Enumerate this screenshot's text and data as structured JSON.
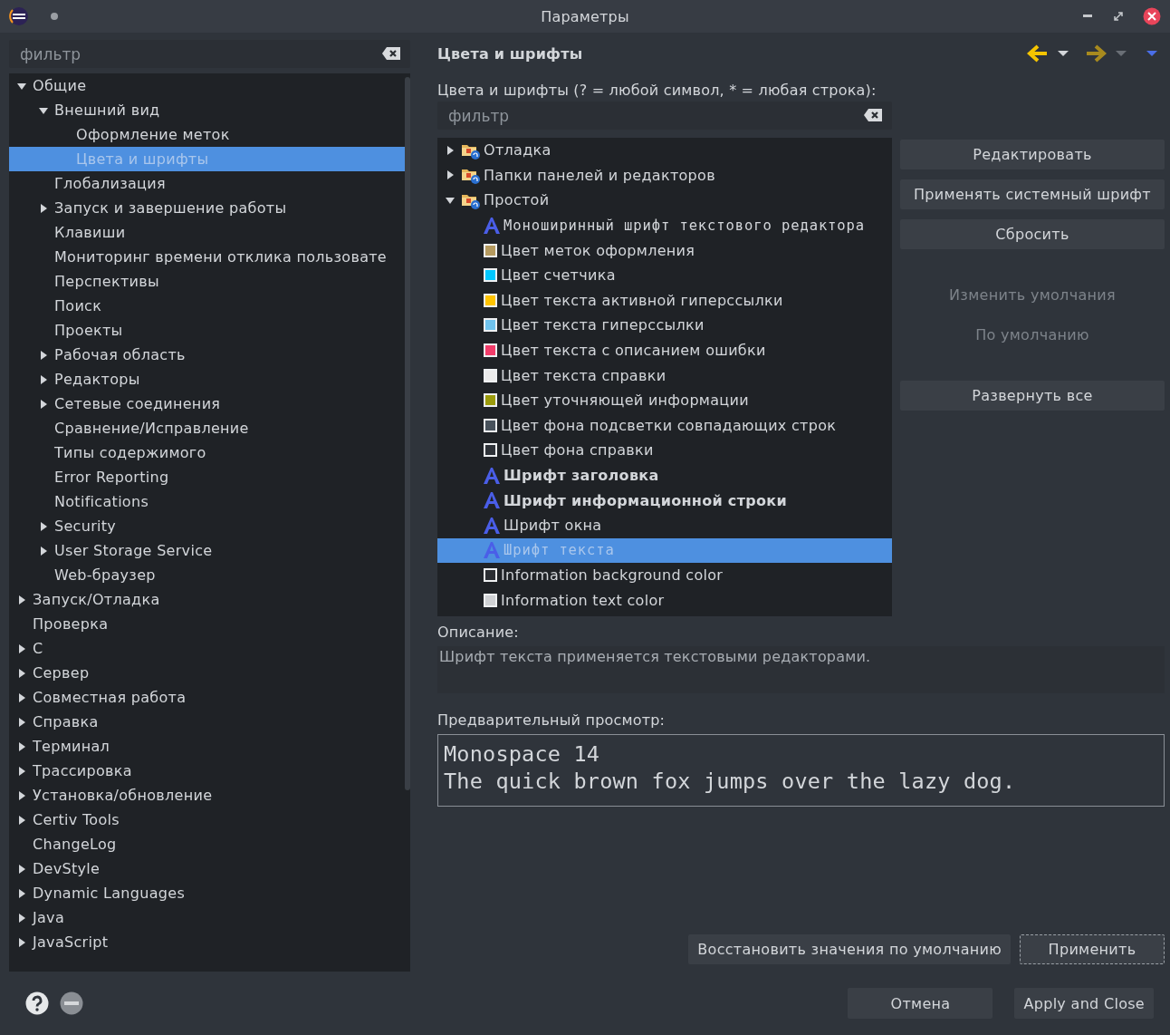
{
  "window": {
    "title": "Параметры"
  },
  "sidebar": {
    "filter_placeholder": "фильтр",
    "tree": [
      {
        "label": "Общие",
        "expanded": true,
        "selected": false,
        "children": [
          {
            "label": "Внешний вид",
            "expanded": true,
            "selected": false,
            "children": [
              {
                "label": "Оформление меток",
                "selected": false
              },
              {
                "label": "Цвета и шрифты",
                "selected": true
              }
            ]
          },
          {
            "label": "Глобализация",
            "selected": false
          },
          {
            "label": "Запуск и завершение работы",
            "expanded": false,
            "selected": false
          },
          {
            "label": "Клавиши",
            "selected": false
          },
          {
            "label": "Мониторинг времени отклика пользовате",
            "selected": false
          },
          {
            "label": "Перспективы",
            "selected": false
          },
          {
            "label": "Поиск",
            "selected": false
          },
          {
            "label": "Проекты",
            "selected": false
          },
          {
            "label": "Рабочая область",
            "expanded": false,
            "selected": false
          },
          {
            "label": "Редакторы",
            "expanded": false,
            "selected": false
          },
          {
            "label": "Сетевые соединения",
            "expanded": false,
            "selected": false
          },
          {
            "label": "Сравнение/Исправление",
            "selected": false
          },
          {
            "label": "Типы содержимого",
            "selected": false
          },
          {
            "label": "Error Reporting",
            "selected": false
          },
          {
            "label": "Notifications",
            "selected": false
          },
          {
            "label": "Security",
            "expanded": false,
            "selected": false
          },
          {
            "label": "User Storage Service",
            "expanded": false,
            "selected": false
          },
          {
            "label": "Web-браузер",
            "selected": false
          }
        ]
      },
      {
        "label": "Запуск/Отладка",
        "expanded": false,
        "selected": false
      },
      {
        "label": "Проверка",
        "selected": false
      },
      {
        "label": "C",
        "expanded": false,
        "selected": false
      },
      {
        "label": "Сервер",
        "expanded": false,
        "selected": false
      },
      {
        "label": "Совместная работа",
        "expanded": false,
        "selected": false
      },
      {
        "label": "Справка",
        "expanded": false,
        "selected": false
      },
      {
        "label": "Терминал",
        "expanded": false,
        "selected": false
      },
      {
        "label": "Трассировка",
        "expanded": false,
        "selected": false
      },
      {
        "label": "Установка/обновление",
        "expanded": false,
        "selected": false
      },
      {
        "label": "Certiv Tools",
        "expanded": false,
        "selected": false
      },
      {
        "label": "ChangeLog",
        "selected": false
      },
      {
        "label": "DevStyle",
        "expanded": false,
        "selected": false
      },
      {
        "label": "Dynamic Languages",
        "expanded": false,
        "selected": false
      },
      {
        "label": "Java",
        "expanded": false,
        "selected": false
      },
      {
        "label": "JavaScript",
        "expanded": false,
        "selected": false
      }
    ]
  },
  "page": {
    "title": "Цвета и шрифты",
    "filter_label": "Цвета и шрифты (? = любой символ, * = любая строка):",
    "filter_placeholder": "фильтр",
    "tree": [
      {
        "kind": "category",
        "label": "Отладка",
        "expanded": false,
        "selected": false
      },
      {
        "kind": "category",
        "label": "Папки панелей и редакторов",
        "expanded": false,
        "selected": false
      },
      {
        "kind": "category",
        "label": "Простой",
        "expanded": true,
        "selected": false,
        "children": [
          {
            "kind": "monofont",
            "label": "Моноширинный шрифт текстового редактора",
            "selected": false
          },
          {
            "kind": "color",
            "color": "#b59a5f",
            "label": "Цвет меток оформления",
            "selected": false
          },
          {
            "kind": "color",
            "color": "#00c8ff",
            "label": "Цвет счетчика",
            "selected": false
          },
          {
            "kind": "color",
            "color": "#ffc400",
            "label": "Цвет текста активной гиперссылки",
            "selected": false
          },
          {
            "kind": "color",
            "color": "#6fc3ee",
            "label": "Цвет текста гиперссылки",
            "selected": false
          },
          {
            "kind": "color",
            "color": "#f23c6a",
            "label": "Цвет текста с описанием ошибки",
            "selected": false
          },
          {
            "kind": "color",
            "color": "#ebebeb",
            "label": "Цвет текста справки",
            "selected": false
          },
          {
            "kind": "color",
            "color": "#9b9b0c",
            "label": "Цвет уточняющей информации",
            "selected": false
          },
          {
            "kind": "color",
            "color": "#48525c",
            "label": "Цвет фона подсветки совпадающих строк",
            "selected": false
          },
          {
            "kind": "color",
            "color": "#2e3238",
            "label": "Цвет фона справки",
            "selected": false
          },
          {
            "kind": "boldfont",
            "label": "Шрифт заголовка",
            "selected": false
          },
          {
            "kind": "boldfont",
            "label": "Шрифт информационной строки",
            "selected": false
          },
          {
            "kind": "font",
            "label": "Шрифт окна",
            "selected": false
          },
          {
            "kind": "monofont",
            "label": "Шрифт текста",
            "selected": true
          },
          {
            "kind": "color",
            "color": "#2b2e33",
            "label": "Information background color",
            "selected": false
          },
          {
            "kind": "color",
            "color": "#cfd1d4",
            "label": "Information text color",
            "selected": false
          }
        ]
      }
    ],
    "buttons": [
      {
        "label": "Редактировать",
        "disabled": false
      },
      {
        "label": "Применять системный шрифт",
        "disabled": false
      },
      {
        "label": "Сбросить",
        "disabled": false
      },
      {
        "label": "Изменить умолчания",
        "disabled": true
      },
      {
        "label": "По умолчанию",
        "disabled": true
      },
      {
        "label": "Развернуть все",
        "disabled": false
      }
    ],
    "description_label": "Описание:",
    "description": "Шрифт текста применяется текстовыми редакторами.",
    "preview_label": "Предварительный просмотр:",
    "preview_lines": [
      "Monospace 14",
      "The quick brown fox jumps over the lazy dog."
    ],
    "restore_button": "Восстановить значения по умолчанию",
    "apply_button": "Применить"
  },
  "footer": {
    "cancel_button": "Отмена",
    "apply_close_button": "Apply and Close"
  }
}
